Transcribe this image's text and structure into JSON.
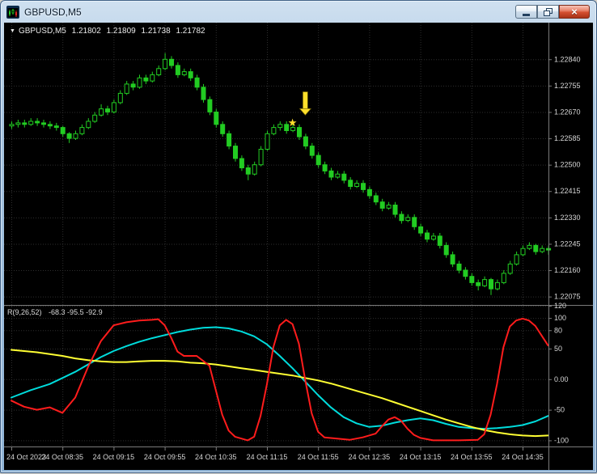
{
  "window": {
    "title": "GBPUSD,M5"
  },
  "icons": {
    "collapse": "▼",
    "close": "×"
  },
  "chart": {
    "header": {
      "symbol": "GBPUSD,M5",
      "open": "1.21802",
      "high": "1.21809",
      "low": "1.21738",
      "close": "1.21782"
    },
    "price_axis": {
      "labels": [
        {
          "price": 1.2284,
          "label": "1.22840"
        },
        {
          "price": 1.22755,
          "label": "1.22755"
        },
        {
          "price": 1.2267,
          "label": "1.22670"
        },
        {
          "price": 1.22585,
          "label": "1.22585"
        },
        {
          "price": 1.225,
          "label": "1.22500"
        },
        {
          "price": 1.22415,
          "label": "1.22415"
        },
        {
          "price": 1.2233,
          "label": "1.22330"
        },
        {
          "price": 1.22245,
          "label": "1.22245"
        },
        {
          "price": 1.2216,
          "label": "1.22160"
        },
        {
          "price": 1.22075,
          "label": "1.22075"
        }
      ]
    },
    "time_axis": {
      "labels": [
        {
          "bar": 0,
          "label": "24 Oct 2023"
        },
        {
          "bar": 8,
          "label": "24 Oct 08:35"
        },
        {
          "bar": 16,
          "label": "24 Oct 09:15"
        },
        {
          "bar": 24,
          "label": "24 Oct 09:55"
        },
        {
          "bar": 32,
          "label": "24 Oct 10:35"
        },
        {
          "bar": 40,
          "label": "24 Oct 11:15"
        },
        {
          "bar": 48,
          "label": "24 Oct 11:55"
        },
        {
          "bar": 56,
          "label": "24 Oct 12:35"
        },
        {
          "bar": 64,
          "label": "24 Oct 13:15"
        },
        {
          "bar": 72,
          "label": "24 Oct 13:55"
        },
        {
          "bar": 80,
          "label": "24 Oct 14:35"
        }
      ]
    }
  },
  "indicator": {
    "name": "R(9,26,52)",
    "values_text": "-68.3 -95.5 -92.9",
    "axis_labels": [
      {
        "value": 120,
        "label": "120"
      },
      {
        "value": 100,
        "label": "100"
      },
      {
        "value": 80,
        "label": "80"
      },
      {
        "value": 50,
        "label": "50"
      },
      {
        "value": 0,
        "label": "0.00"
      },
      {
        "value": -50,
        "label": "-50"
      },
      {
        "value": -100,
        "label": "-100"
      }
    ]
  },
  "colors": {
    "background": "#000000",
    "grid": "#2e2e2e",
    "candle": "#22cc22",
    "candle_up_fill": "#000000",
    "candle_down_fill": "#22cc22",
    "axis_text": "#d6d6d6",
    "axis_line": "#7a7a7a",
    "annotation": "#ffdf2b"
  },
  "chart_data": {
    "type": "candlestick",
    "symbol": "GBPUSD",
    "timeframe": "M5",
    "price_range": {
      "top": 1.22958,
      "bottom": 1.22048
    },
    "candles": [
      [
        1.22625,
        1.2264,
        1.22615,
        1.2263
      ],
      [
        1.2263,
        1.22645,
        1.2262,
        1.22635
      ],
      [
        1.22635,
        1.22645,
        1.2262,
        1.2263
      ],
      [
        1.2263,
        1.2265,
        1.22625,
        1.2264
      ],
      [
        1.2264,
        1.2265,
        1.22625,
        1.22635
      ],
      [
        1.22635,
        1.22645,
        1.2262,
        1.2263
      ],
      [
        1.2263,
        1.2264,
        1.22615,
        1.22625
      ],
      [
        1.22625,
        1.22635,
        1.2261,
        1.2262
      ],
      [
        1.2262,
        1.22625,
        1.2259,
        1.226
      ],
      [
        1.226,
        1.22605,
        1.2257,
        1.22585
      ],
      [
        1.22585,
        1.2261,
        1.2258,
        1.226
      ],
      [
        1.226,
        1.2263,
        1.22595,
        1.2262
      ],
      [
        1.2262,
        1.2265,
        1.22615,
        1.2264
      ],
      [
        1.2264,
        1.2267,
        1.22635,
        1.2266
      ],
      [
        1.2266,
        1.22695,
        1.22655,
        1.2268
      ],
      [
        1.2268,
        1.2269,
        1.2266,
        1.2267
      ],
      [
        1.2267,
        1.2271,
        1.22665,
        1.227
      ],
      [
        1.227,
        1.2274,
        1.22695,
        1.2273
      ],
      [
        1.2273,
        1.2277,
        1.22725,
        1.2276
      ],
      [
        1.2276,
        1.2277,
        1.2274,
        1.2275
      ],
      [
        1.2275,
        1.2279,
        1.22745,
        1.2278
      ],
      [
        1.2278,
        1.2279,
        1.2276,
        1.2277
      ],
      [
        1.2277,
        1.228,
        1.22765,
        1.2279
      ],
      [
        1.2279,
        1.2282,
        1.22785,
        1.2281
      ],
      [
        1.2281,
        1.2286,
        1.22805,
        1.2284
      ],
      [
        1.2284,
        1.2285,
        1.2281,
        1.2282
      ],
      [
        1.2282,
        1.2283,
        1.2278,
        1.2279
      ],
      [
        1.2279,
        1.2281,
        1.22785,
        1.228
      ],
      [
        1.228,
        1.2281,
        1.2277,
        1.2278
      ],
      [
        1.2278,
        1.2279,
        1.2274,
        1.2275
      ],
      [
        1.2275,
        1.2276,
        1.227,
        1.2271
      ],
      [
        1.2271,
        1.2272,
        1.2266,
        1.2267
      ],
      [
        1.2267,
        1.2268,
        1.2262,
        1.2263
      ],
      [
        1.2263,
        1.2264,
        1.2259,
        1.226
      ],
      [
        1.226,
        1.2261,
        1.2255,
        1.2256
      ],
      [
        1.2256,
        1.2257,
        1.2251,
        1.2252
      ],
      [
        1.2252,
        1.2253,
        1.2248,
        1.2249
      ],
      [
        1.2249,
        1.225,
        1.2245,
        1.2247
      ],
      [
        1.2247,
        1.2251,
        1.22465,
        1.225
      ],
      [
        1.225,
        1.2256,
        1.22495,
        1.2255
      ],
      [
        1.2255,
        1.2261,
        1.22545,
        1.226
      ],
      [
        1.226,
        1.2263,
        1.22595,
        1.2262
      ],
      [
        1.2262,
        1.2264,
        1.2261,
        1.2263
      ],
      [
        1.2263,
        1.2264,
        1.226,
        1.2261
      ],
      [
        1.2261,
        1.2263,
        1.22605,
        1.2262
      ],
      [
        1.2262,
        1.2263,
        1.2258,
        1.2259
      ],
      [
        1.2259,
        1.226,
        1.2255,
        1.2256
      ],
      [
        1.2256,
        1.2257,
        1.2252,
        1.2253
      ],
      [
        1.2253,
        1.2254,
        1.2249,
        1.225
      ],
      [
        1.225,
        1.2251,
        1.2247,
        1.2248
      ],
      [
        1.2248,
        1.2249,
        1.2245,
        1.2246
      ],
      [
        1.2246,
        1.2248,
        1.22455,
        1.2247
      ],
      [
        1.2247,
        1.2248,
        1.2244,
        1.2245
      ],
      [
        1.2245,
        1.2246,
        1.2242,
        1.2243
      ],
      [
        1.2243,
        1.2245,
        1.22425,
        1.2244
      ],
      [
        1.2244,
        1.2245,
        1.2241,
        1.2242
      ],
      [
        1.2242,
        1.2243,
        1.2239,
        1.224
      ],
      [
        1.224,
        1.2241,
        1.2237,
        1.2238
      ],
      [
        1.2238,
        1.2239,
        1.2235,
        1.2236
      ],
      [
        1.2236,
        1.2238,
        1.22355,
        1.2237
      ],
      [
        1.2237,
        1.2238,
        1.2233,
        1.2234
      ],
      [
        1.2234,
        1.2235,
        1.2231,
        1.2232
      ],
      [
        1.2232,
        1.2234,
        1.22315,
        1.2233
      ],
      [
        1.2233,
        1.2234,
        1.2229,
        1.223
      ],
      [
        1.223,
        1.2231,
        1.2227,
        1.2228
      ],
      [
        1.2228,
        1.2229,
        1.2225,
        1.2226
      ],
      [
        1.2226,
        1.2228,
        1.22255,
        1.2227
      ],
      [
        1.2227,
        1.2228,
        1.2223,
        1.2224
      ],
      [
        1.2224,
        1.2225,
        1.222,
        1.2221
      ],
      [
        1.2221,
        1.2222,
        1.2217,
        1.2218
      ],
      [
        1.2218,
        1.2219,
        1.2215,
        1.2216
      ],
      [
        1.2216,
        1.2217,
        1.2213,
        1.2214
      ],
      [
        1.2214,
        1.2215,
        1.2211,
        1.2212
      ],
      [
        1.2212,
        1.2213,
        1.22095,
        1.2211
      ],
      [
        1.2211,
        1.2214,
        1.22105,
        1.2213
      ],
      [
        1.2213,
        1.22135,
        1.2208,
        1.221
      ],
      [
        1.221,
        1.2213,
        1.22095,
        1.2212
      ],
      [
        1.2212,
        1.2216,
        1.22115,
        1.2215
      ],
      [
        1.2215,
        1.2219,
        1.22145,
        1.2218
      ],
      [
        1.2218,
        1.2222,
        1.22175,
        1.2221
      ],
      [
        1.2221,
        1.2224,
        1.22205,
        1.2223
      ],
      [
        1.2223,
        1.2225,
        1.22225,
        1.2224
      ],
      [
        1.2224,
        1.22245,
        1.2221,
        1.2222
      ],
      [
        1.2222,
        1.2224,
        1.22215,
        1.2223
      ],
      [
        1.2223,
        1.2224,
        1.2221,
        1.22225
      ]
    ],
    "annotations": [
      {
        "type": "star",
        "bar": 44,
        "price": 1.22635
      },
      {
        "type": "arrow-down",
        "bar": 46,
        "price_top": 1.22735,
        "price_bottom": 1.2266
      }
    ],
    "oscillator": {
      "type": "line",
      "name": "R(9,26,52)",
      "range": [
        -110,
        120
      ],
      "series": [
        {
          "name": "medium",
          "color": "#00dcdc",
          "points": [
            [
              0,
              -30
            ],
            [
              3,
              -18
            ],
            [
              6,
              -8
            ],
            [
              8,
              2
            ],
            [
              10,
              12
            ],
            [
              12,
              24
            ],
            [
              14,
              36
            ],
            [
              16,
              46
            ],
            [
              18,
              54
            ],
            [
              20,
              61
            ],
            [
              22,
              67
            ],
            [
              24,
              72
            ],
            [
              26,
              77
            ],
            [
              28,
              81
            ],
            [
              30,
              84
            ],
            [
              32,
              85
            ],
            [
              34,
              83
            ],
            [
              36,
              78
            ],
            [
              38,
              70
            ],
            [
              40,
              57
            ],
            [
              42,
              38
            ],
            [
              44,
              18
            ],
            [
              46,
              -4
            ],
            [
              48,
              -26
            ],
            [
              50,
              -46
            ],
            [
              52,
              -62
            ],
            [
              54,
              -72
            ],
            [
              56,
              -78
            ],
            [
              58,
              -76
            ],
            [
              60,
              -71
            ],
            [
              62,
              -67
            ],
            [
              64,
              -64
            ],
            [
              66,
              -67
            ],
            [
              68,
              -73
            ],
            [
              70,
              -78
            ],
            [
              72,
              -80
            ],
            [
              74,
              -81
            ],
            [
              76,
              -80
            ],
            [
              78,
              -78
            ],
            [
              80,
              -75
            ],
            [
              82,
              -69
            ],
            [
              84,
              -60
            ]
          ]
        },
        {
          "name": "slow",
          "color": "#ffff33",
          "points": [
            [
              0,
              48
            ],
            [
              2,
              46
            ],
            [
              4,
              44
            ],
            [
              6,
              41
            ],
            [
              8,
              38
            ],
            [
              10,
              34
            ],
            [
              12,
              31
            ],
            [
              14,
              29
            ],
            [
              16,
              28
            ],
            [
              18,
              28
            ],
            [
              20,
              29
            ],
            [
              22,
              30
            ],
            [
              24,
              30
            ],
            [
              26,
              29
            ],
            [
              28,
              27
            ],
            [
              30,
              26
            ],
            [
              32,
              24
            ],
            [
              34,
              21
            ],
            [
              36,
              18
            ],
            [
              38,
              15
            ],
            [
              40,
              12
            ],
            [
              42,
              9
            ],
            [
              44,
              6
            ],
            [
              46,
              2
            ],
            [
              48,
              -2
            ],
            [
              50,
              -7
            ],
            [
              52,
              -13
            ],
            [
              54,
              -19
            ],
            [
              56,
              -25
            ],
            [
              58,
              -31
            ],
            [
              60,
              -38
            ],
            [
              62,
              -45
            ],
            [
              64,
              -52
            ],
            [
              66,
              -59
            ],
            [
              68,
              -66
            ],
            [
              70,
              -72
            ],
            [
              72,
              -78
            ],
            [
              74,
              -83
            ],
            [
              76,
              -87
            ],
            [
              78,
              -90
            ],
            [
              80,
              -92
            ],
            [
              82,
              -93
            ],
            [
              84,
              -92
            ]
          ]
        },
        {
          "name": "fast",
          "color": "#ff1c1c",
          "points": [
            [
              0,
              -35
            ],
            [
              2,
              -45
            ],
            [
              4,
              -50
            ],
            [
              6,
              -46
            ],
            [
              8,
              -55
            ],
            [
              10,
              -30
            ],
            [
              12,
              20
            ],
            [
              14,
              62
            ],
            [
              16,
              88
            ],
            [
              18,
              93
            ],
            [
              20,
              96
            ],
            [
              22,
              97
            ],
            [
              23,
              98
            ],
            [
              24,
              88
            ],
            [
              25,
              68
            ],
            [
              26,
              45
            ],
            [
              27,
              38
            ],
            [
              29,
              38
            ],
            [
              31,
              22
            ],
            [
              32,
              -18
            ],
            [
              33,
              -58
            ],
            [
              34,
              -84
            ],
            [
              35,
              -94
            ],
            [
              37,
              -100
            ],
            [
              38,
              -94
            ],
            [
              39,
              -60
            ],
            [
              40,
              -8
            ],
            [
              41,
              52
            ],
            [
              42,
              88
            ],
            [
              43,
              97
            ],
            [
              44,
              90
            ],
            [
              45,
              58
            ],
            [
              46,
              -2
            ],
            [
              47,
              -56
            ],
            [
              48,
              -86
            ],
            [
              49,
              -95
            ],
            [
              51,
              -97
            ],
            [
              53,
              -99
            ],
            [
              55,
              -95
            ],
            [
              57,
              -89
            ],
            [
              58,
              -77
            ],
            [
              59,
              -66
            ],
            [
              60,
              -62
            ],
            [
              61,
              -68
            ],
            [
              62,
              -81
            ],
            [
              63,
              -91
            ],
            [
              64,
              -96
            ],
            [
              66,
              -100
            ],
            [
              70,
              -100
            ],
            [
              73,
              -99
            ],
            [
              74,
              -90
            ],
            [
              75,
              -58
            ],
            [
              76,
              -8
            ],
            [
              77,
              52
            ],
            [
              78,
              86
            ],
            [
              79,
              96
            ],
            [
              80,
              99
            ],
            [
              81,
              96
            ],
            [
              82,
              87
            ],
            [
              83,
              71
            ],
            [
              84,
              55
            ]
          ]
        }
      ]
    }
  }
}
